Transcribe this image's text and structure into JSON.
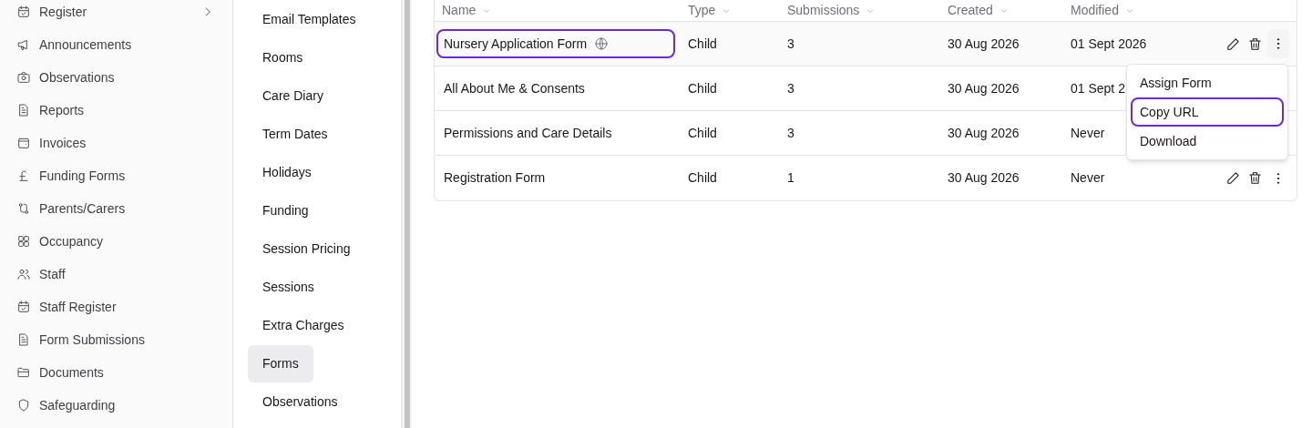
{
  "sidebar": {
    "items": [
      {
        "label": "Register",
        "has_submenu": true
      },
      {
        "label": "Announcements",
        "has_submenu": false
      },
      {
        "label": "Observations",
        "has_submenu": false
      },
      {
        "label": "Reports",
        "has_submenu": false
      },
      {
        "label": "Invoices",
        "has_submenu": false
      },
      {
        "label": "Funding Forms",
        "has_submenu": false
      },
      {
        "label": "Parents/Carers",
        "has_submenu": false
      },
      {
        "label": "Occupancy",
        "has_submenu": false
      },
      {
        "label": "Staff",
        "has_submenu": false
      },
      {
        "label": "Staff Register",
        "has_submenu": false
      },
      {
        "label": "Form Submissions",
        "has_submenu": false
      },
      {
        "label": "Documents",
        "has_submenu": false
      },
      {
        "label": "Safeguarding",
        "has_submenu": false
      }
    ]
  },
  "settings_nav": {
    "items": [
      {
        "label": "Email Templates",
        "selected": false
      },
      {
        "label": "Rooms",
        "selected": false
      },
      {
        "label": "Care Diary",
        "selected": false
      },
      {
        "label": "Term Dates",
        "selected": false
      },
      {
        "label": "Holidays",
        "selected": false
      },
      {
        "label": "Funding",
        "selected": false
      },
      {
        "label": "Session Pricing",
        "selected": false
      },
      {
        "label": "Sessions",
        "selected": false
      },
      {
        "label": "Extra Charges",
        "selected": false
      },
      {
        "label": "Forms",
        "selected": true
      },
      {
        "label": "Observations",
        "selected": false
      }
    ]
  },
  "table": {
    "columns": [
      "Name",
      "Type",
      "Submissions",
      "Created",
      "Modified"
    ],
    "rows": [
      {
        "name": "Nursery Application Form",
        "public": true,
        "type": "Child",
        "submissions": "3",
        "created": "30 Aug 2026",
        "modified": "01 Sept 2026",
        "selected": true
      },
      {
        "name": "All About Me & Consents",
        "public": false,
        "type": "Child",
        "submissions": "3",
        "created": "30 Aug 2026",
        "modified": "01 Sept 2",
        "selected": false
      },
      {
        "name": "Permissions and Care Details",
        "public": false,
        "type": "Child",
        "submissions": "3",
        "created": "30 Aug 2026",
        "modified": "Never",
        "selected": false
      },
      {
        "name": "Registration Form",
        "public": false,
        "type": "Child",
        "submissions": "1",
        "created": "30 Aug 2026",
        "modified": "Never",
        "selected": false
      }
    ]
  },
  "row_menu": {
    "items": [
      {
        "label": "Assign Form",
        "focused": false
      },
      {
        "label": "Copy URL",
        "focused": true
      },
      {
        "label": "Download",
        "focused": false
      }
    ]
  }
}
